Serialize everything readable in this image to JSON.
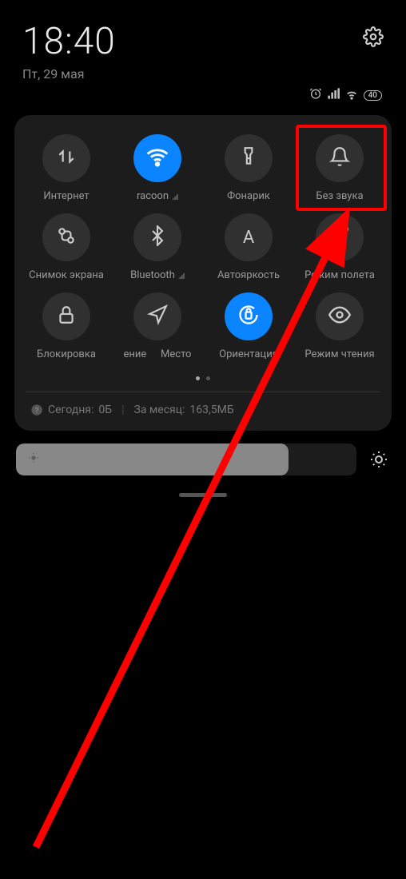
{
  "header": {
    "time": "18:40",
    "date": "Пт, 29 мая"
  },
  "status": {
    "battery_text": "40"
  },
  "tiles": [
    {
      "label": "Интернет",
      "kind": "data"
    },
    {
      "label": "racoon",
      "kind": "wifi",
      "active": true
    },
    {
      "label": "Фонарик",
      "kind": "flashlight"
    },
    {
      "label": "Без звука",
      "kind": "mute"
    },
    {
      "label": "Снимок экрана",
      "kind": "screenshot"
    },
    {
      "label": "Bluetooth",
      "kind": "bluetooth"
    },
    {
      "label": "Автояркость",
      "kind": "auto_brightness_letter"
    },
    {
      "label": "Режим полета",
      "kind": "airplane"
    },
    {
      "label": "Блокировка",
      "kind": "lock"
    },
    {
      "label": "ение",
      "kind": "location"
    },
    {
      "label": "Место",
      "kind": "location2"
    },
    {
      "label": "Ориентация",
      "kind": "orientation",
      "active": true
    },
    {
      "label": "Режим чтения",
      "kind": "reading"
    }
  ],
  "data_usage": {
    "today_label": "Сегодня:",
    "today_value": "0Б",
    "month_label": "За месяц:",
    "month_value": "163,5МБ"
  }
}
